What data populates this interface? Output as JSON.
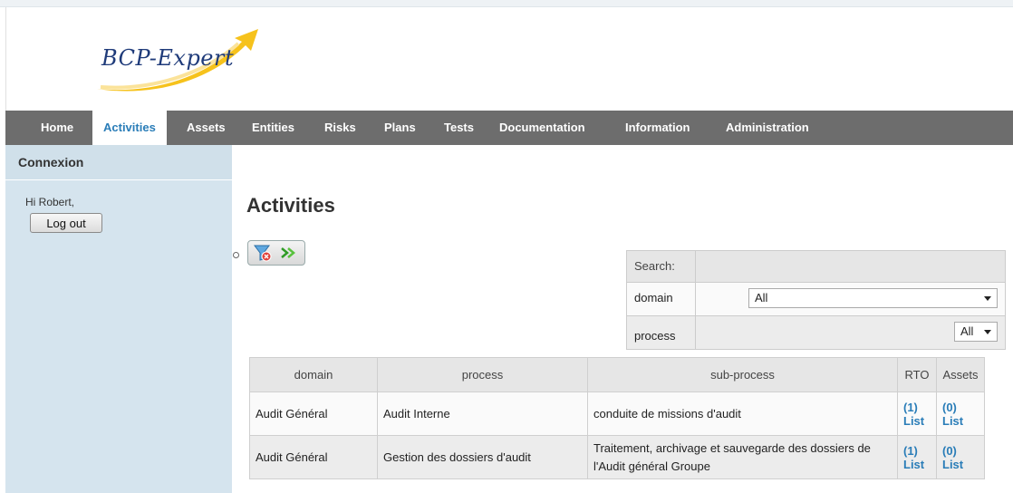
{
  "app": {
    "logo_text": "BCP-Expert"
  },
  "nav": {
    "items": [
      {
        "label": "Home"
      },
      {
        "label": "Activities",
        "active": true
      },
      {
        "label": "Assets"
      },
      {
        "label": "Entities"
      },
      {
        "label": "Risks"
      },
      {
        "label": "Plans"
      },
      {
        "label": "Tests"
      },
      {
        "label": "Documentation"
      },
      {
        "label": "Information"
      },
      {
        "label": "Administration"
      }
    ]
  },
  "sidebar": {
    "title": "Connexion",
    "greeting": "Hi Robert,",
    "logout_label": "Log out"
  },
  "main": {
    "title": "Activities",
    "toolbar": {
      "icons": [
        "filter-clear-icon",
        "green-arrows-icon"
      ]
    },
    "search": {
      "header": "Search:",
      "domain_label": "domain",
      "domain_value": "All",
      "process_label": "process",
      "process_value": "All"
    },
    "table": {
      "columns": [
        "domain",
        "process",
        "sub-process",
        "RTO",
        "Assets"
      ],
      "rows": [
        {
          "domain": "Audit Général",
          "process": "Audit Interne",
          "subprocess": "conduite de missions d'audit",
          "rto_count": "(1)",
          "rto_link": "List",
          "assets_count": "(0)",
          "assets_link": "List"
        },
        {
          "domain": "Audit Général",
          "process": "Gestion des dossiers d'audit",
          "subprocess": "Traitement, archivage et sauvegarde des dossiers de l'Audit général Groupe",
          "rto_count": "(1)",
          "rto_link": "List",
          "assets_count": "(0)",
          "assets_link": "List"
        }
      ]
    }
  },
  "colors": {
    "nav_bg": "#6d6d6d",
    "accent_link": "#2a7db8",
    "sidebar_bg": "#d5e4ee",
    "logo_swoosh": "#f6c21c",
    "logo_text": "#1f3b7a"
  }
}
